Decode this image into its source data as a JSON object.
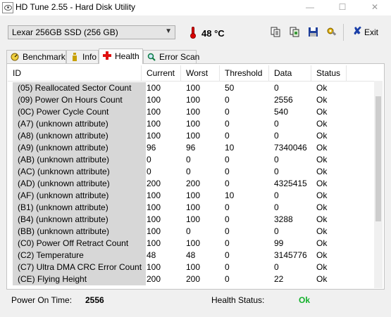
{
  "window": {
    "title": "HD Tune 2.55 - Hard Disk Utility",
    "minimize": "—",
    "maximize": "☐",
    "close": "✕"
  },
  "toolbar": {
    "drive": "Lexar   256GB SSD (256 GB)",
    "temperature": "48 °C",
    "exit_label": "Exit"
  },
  "tabs": [
    {
      "label": "Benchmark",
      "icon": "benchmark-icon"
    },
    {
      "label": "Info",
      "icon": "info-icon"
    },
    {
      "label": "Health",
      "icon": "health-cross-icon",
      "active": true
    },
    {
      "label": "Error Scan",
      "icon": "magnifier-icon"
    }
  ],
  "table": {
    "columns": [
      "ID",
      "Current",
      "Worst",
      "Threshold",
      "Data",
      "Status"
    ],
    "rows": [
      [
        "(05) Reallocated Sector Count",
        "100",
        "100",
        "50",
        "0",
        "Ok"
      ],
      [
        "(09) Power On Hours Count",
        "100",
        "100",
        "0",
        "2556",
        "Ok"
      ],
      [
        "(0C) Power Cycle Count",
        "100",
        "100",
        "0",
        "540",
        "Ok"
      ],
      [
        "(A7) (unknown attribute)",
        "100",
        "100",
        "0",
        "0",
        "Ok"
      ],
      [
        "(A8) (unknown attribute)",
        "100",
        "100",
        "0",
        "0",
        "Ok"
      ],
      [
        "(A9) (unknown attribute)",
        "96",
        "96",
        "10",
        "7340046",
        "Ok"
      ],
      [
        "(AB) (unknown attribute)",
        "0",
        "0",
        "0",
        "0",
        "Ok"
      ],
      [
        "(AC) (unknown attribute)",
        "0",
        "0",
        "0",
        "0",
        "Ok"
      ],
      [
        "(AD) (unknown attribute)",
        "200",
        "200",
        "0",
        "4325415",
        "Ok"
      ],
      [
        "(AF) (unknown attribute)",
        "100",
        "100",
        "10",
        "0",
        "Ok"
      ],
      [
        "(B1) (unknown attribute)",
        "100",
        "100",
        "0",
        "0",
        "Ok"
      ],
      [
        "(B4) (unknown attribute)",
        "100",
        "100",
        "0",
        "3288",
        "Ok"
      ],
      [
        "(BB) (unknown attribute)",
        "100",
        "0",
        "0",
        "0",
        "Ok"
      ],
      [
        "(C0) Power Off Retract Count",
        "100",
        "100",
        "0",
        "99",
        "Ok"
      ],
      [
        "(C2) Temperature",
        "48",
        "48",
        "0",
        "3145776",
        "Ok"
      ],
      [
        "(C7) Ultra DMA CRC Error Count",
        "100",
        "100",
        "0",
        "0",
        "Ok"
      ],
      [
        "(CE) Flying Height",
        "200",
        "200",
        "0",
        "22",
        "Ok"
      ]
    ]
  },
  "footer": {
    "power_on_label": "Power On Time:",
    "power_on_value": "2556",
    "health_label": "Health Status:",
    "health_value": "Ok"
  }
}
